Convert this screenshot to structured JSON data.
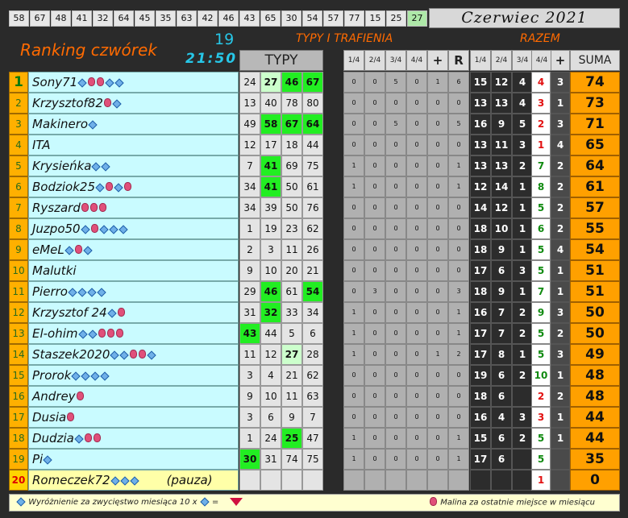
{
  "top_numbers": [
    "58",
    "67",
    "48",
    "41",
    "32",
    "64",
    "45",
    "35",
    "63",
    "42",
    "46",
    "43",
    "65",
    "30",
    "54",
    "57",
    "77",
    "15",
    "25",
    "27"
  ],
  "top_highlight_index": 19,
  "month": "Czerwiec  2021",
  "title": "Ranking czwórek",
  "round": "19",
  "clock": "21:50",
  "section_typy_trafienia": "TYPY I TRAFIENIA",
  "section_razem": "RAZEM",
  "header": {
    "typy": "TYPY",
    "score_cols": [
      "1/4",
      "2/4",
      "3/4",
      "4/4",
      "+",
      "R"
    ],
    "razem_cols": [
      "1/4",
      "2/4",
      "3/4",
      "4/4",
      "+"
    ],
    "suma": "SUMA"
  },
  "rows": [
    {
      "rank": "1",
      "name": "Sony71",
      "marks": [
        "d",
        "r",
        "r",
        "d",
        "d"
      ],
      "typy": [
        {
          "v": "24",
          "s": ""
        },
        {
          "v": "27",
          "s": "lg"
        },
        {
          "v": "46",
          "s": "g"
        },
        {
          "v": "67",
          "s": "g"
        }
      ],
      "scores": [
        "0",
        "0",
        "5",
        "0",
        "1",
        "6"
      ],
      "razem": [
        "15",
        "12",
        "4",
        "4",
        "3"
      ],
      "suma": "74"
    },
    {
      "rank": "2",
      "name": "Krzysztof82",
      "marks": [
        "r",
        "d"
      ],
      "typy": [
        {
          "v": "13",
          "s": ""
        },
        {
          "v": "40",
          "s": ""
        },
        {
          "v": "78",
          "s": ""
        },
        {
          "v": "80",
          "s": ""
        }
      ],
      "scores": [
        "0",
        "0",
        "0",
        "0",
        "0",
        "0"
      ],
      "razem": [
        "13",
        "13",
        "4",
        "3",
        "1"
      ],
      "suma": "73"
    },
    {
      "rank": "3",
      "name": "Makinero",
      "marks": [
        "d"
      ],
      "typy": [
        {
          "v": "49",
          "s": ""
        },
        {
          "v": "58",
          "s": "g"
        },
        {
          "v": "67",
          "s": "g"
        },
        {
          "v": "64",
          "s": "g"
        }
      ],
      "scores": [
        "0",
        "0",
        "5",
        "0",
        "0",
        "5"
      ],
      "razem": [
        "16",
        "9",
        "5",
        "2",
        "3"
      ],
      "suma": "71"
    },
    {
      "rank": "4",
      "name": "ITA",
      "marks": [],
      "typy": [
        {
          "v": "12",
          "s": ""
        },
        {
          "v": "17",
          "s": ""
        },
        {
          "v": "18",
          "s": ""
        },
        {
          "v": "44",
          "s": ""
        }
      ],
      "scores": [
        "0",
        "0",
        "0",
        "0",
        "0",
        "0"
      ],
      "razem": [
        "13",
        "11",
        "3",
        "1",
        "4"
      ],
      "suma": "65"
    },
    {
      "rank": "5",
      "name": "Krysieńka",
      "marks": [
        "d",
        "d"
      ],
      "typy": [
        {
          "v": "7",
          "s": ""
        },
        {
          "v": "41",
          "s": "g"
        },
        {
          "v": "69",
          "s": ""
        },
        {
          "v": "75",
          "s": ""
        }
      ],
      "scores": [
        "1",
        "0",
        "0",
        "0",
        "0",
        "1"
      ],
      "razem": [
        "13",
        "13",
        "2",
        "7",
        "2"
      ],
      "suma": "64"
    },
    {
      "rank": "6",
      "name": "Bodziok25",
      "marks": [
        "d",
        "r",
        "d",
        "r"
      ],
      "typy": [
        {
          "v": "34",
          "s": ""
        },
        {
          "v": "41",
          "s": "g"
        },
        {
          "v": "50",
          "s": ""
        },
        {
          "v": "61",
          "s": ""
        }
      ],
      "scores": [
        "1",
        "0",
        "0",
        "0",
        "0",
        "1"
      ],
      "razem": [
        "12",
        "14",
        "1",
        "8",
        "2"
      ],
      "suma": "61"
    },
    {
      "rank": "7",
      "name": "Ryszard",
      "marks": [
        "r",
        "r",
        "r"
      ],
      "typy": [
        {
          "v": "34",
          "s": ""
        },
        {
          "v": "39",
          "s": ""
        },
        {
          "v": "50",
          "s": ""
        },
        {
          "v": "76",
          "s": ""
        }
      ],
      "scores": [
        "0",
        "0",
        "0",
        "0",
        "0",
        "0"
      ],
      "razem": [
        "14",
        "12",
        "1",
        "5",
        "2"
      ],
      "suma": "57"
    },
    {
      "rank": "8",
      "name": "Juzpo50",
      "marks": [
        "d",
        "r",
        "d",
        "d",
        "d"
      ],
      "typy": [
        {
          "v": "1",
          "s": ""
        },
        {
          "v": "19",
          "s": ""
        },
        {
          "v": "23",
          "s": ""
        },
        {
          "v": "62",
          "s": ""
        }
      ],
      "scores": [
        "0",
        "0",
        "0",
        "0",
        "0",
        "0"
      ],
      "razem": [
        "18",
        "10",
        "1",
        "6",
        "2"
      ],
      "suma": "55"
    },
    {
      "rank": "9",
      "name": "eMeL",
      "marks": [
        "d",
        "r",
        "d"
      ],
      "typy": [
        {
          "v": "2",
          "s": ""
        },
        {
          "v": "3",
          "s": ""
        },
        {
          "v": "11",
          "s": ""
        },
        {
          "v": "26",
          "s": ""
        }
      ],
      "scores": [
        "0",
        "0",
        "0",
        "0",
        "0",
        "0"
      ],
      "razem": [
        "18",
        "9",
        "1",
        "5",
        "4"
      ],
      "suma": "54"
    },
    {
      "rank": "10",
      "name": "Malutki",
      "marks": [],
      "typy": [
        {
          "v": "9",
          "s": ""
        },
        {
          "v": "10",
          "s": ""
        },
        {
          "v": "20",
          "s": ""
        },
        {
          "v": "21",
          "s": ""
        }
      ],
      "scores": [
        "0",
        "0",
        "0",
        "0",
        "0",
        "0"
      ],
      "razem": [
        "17",
        "6",
        "3",
        "5",
        "1"
      ],
      "suma": "51"
    },
    {
      "rank": "11",
      "name": "Pierro",
      "marks": [
        "d",
        "d",
        "d",
        "d"
      ],
      "typy": [
        {
          "v": "29",
          "s": ""
        },
        {
          "v": "46",
          "s": "g"
        },
        {
          "v": "61",
          "s": ""
        },
        {
          "v": "54",
          "s": "g"
        }
      ],
      "scores": [
        "0",
        "3",
        "0",
        "0",
        "0",
        "3"
      ],
      "razem": [
        "18",
        "9",
        "1",
        "7",
        "1"
      ],
      "suma": "51"
    },
    {
      "rank": "12",
      "name": "Krzysztof 24",
      "marks": [
        "d",
        "r"
      ],
      "typy": [
        {
          "v": "31",
          "s": ""
        },
        {
          "v": "32",
          "s": "g"
        },
        {
          "v": "33",
          "s": ""
        },
        {
          "v": "34",
          "s": ""
        }
      ],
      "scores": [
        "1",
        "0",
        "0",
        "0",
        "0",
        "1"
      ],
      "razem": [
        "16",
        "7",
        "2",
        "9",
        "3"
      ],
      "suma": "50"
    },
    {
      "rank": "13",
      "name": "El-ohim",
      "marks": [
        "d",
        "d",
        "r",
        "r",
        "r"
      ],
      "typy": [
        {
          "v": "43",
          "s": "g"
        },
        {
          "v": "44",
          "s": ""
        },
        {
          "v": "5",
          "s": ""
        },
        {
          "v": "6",
          "s": ""
        }
      ],
      "scores": [
        "1",
        "0",
        "0",
        "0",
        "0",
        "1"
      ],
      "razem": [
        "17",
        "7",
        "2",
        "5",
        "2"
      ],
      "suma": "50"
    },
    {
      "rank": "14",
      "name": "Staszek2020",
      "marks": [
        "d",
        "d",
        "r",
        "r",
        "d"
      ],
      "typy": [
        {
          "v": "11",
          "s": ""
        },
        {
          "v": "12",
          "s": ""
        },
        {
          "v": "27",
          "s": "lg"
        },
        {
          "v": "28",
          "s": ""
        }
      ],
      "scores": [
        "1",
        "0",
        "0",
        "0",
        "1",
        "2"
      ],
      "razem": [
        "17",
        "8",
        "1",
        "5",
        "3"
      ],
      "suma": "49"
    },
    {
      "rank": "15",
      "name": "Prorok",
      "marks": [
        "d",
        "d",
        "d",
        "d"
      ],
      "typy": [
        {
          "v": "3",
          "s": ""
        },
        {
          "v": "4",
          "s": ""
        },
        {
          "v": "21",
          "s": ""
        },
        {
          "v": "62",
          "s": ""
        }
      ],
      "scores": [
        "0",
        "0",
        "0",
        "0",
        "0",
        "0"
      ],
      "razem": [
        "19",
        "6",
        "2",
        "10",
        "1"
      ],
      "suma": "48"
    },
    {
      "rank": "16",
      "name": "Andrey",
      "marks": [
        "r"
      ],
      "typy": [
        {
          "v": "9",
          "s": ""
        },
        {
          "v": "10",
          "s": ""
        },
        {
          "v": "11",
          "s": ""
        },
        {
          "v": "63",
          "s": ""
        }
      ],
      "scores": [
        "0",
        "0",
        "0",
        "0",
        "0",
        "0"
      ],
      "razem": [
        "18",
        "6",
        "",
        "2",
        "2"
      ],
      "suma": "48"
    },
    {
      "rank": "17",
      "name": "Dusia",
      "marks": [
        "r"
      ],
      "typy": [
        {
          "v": "3",
          "s": ""
        },
        {
          "v": "6",
          "s": ""
        },
        {
          "v": "9",
          "s": ""
        },
        {
          "v": "7",
          "s": ""
        }
      ],
      "scores": [
        "0",
        "0",
        "0",
        "0",
        "0",
        "0"
      ],
      "razem": [
        "16",
        "4",
        "3",
        "3",
        "1"
      ],
      "suma": "44"
    },
    {
      "rank": "18",
      "name": "Dudzia",
      "marks": [
        "d",
        "r",
        "r"
      ],
      "typy": [
        {
          "v": "1",
          "s": ""
        },
        {
          "v": "24",
          "s": ""
        },
        {
          "v": "25",
          "s": "g"
        },
        {
          "v": "47",
          "s": ""
        }
      ],
      "scores": [
        "1",
        "0",
        "0",
        "0",
        "0",
        "1"
      ],
      "razem": [
        "15",
        "6",
        "2",
        "5",
        "1"
      ],
      "suma": "44"
    },
    {
      "rank": "19",
      "name": "Pi",
      "marks": [
        "d"
      ],
      "typy": [
        {
          "v": "30",
          "s": "g"
        },
        {
          "v": "31",
          "s": ""
        },
        {
          "v": "74",
          "s": ""
        },
        {
          "v": "75",
          "s": ""
        }
      ],
      "scores": [
        "1",
        "0",
        "0",
        "0",
        "0",
        "1"
      ],
      "razem": [
        "17",
        "6",
        "",
        "5",
        ""
      ],
      "suma": "35"
    },
    {
      "rank": "20",
      "name": "Romeczek72",
      "marks": [
        "d",
        "d",
        "d"
      ],
      "pauza": "(pauza)",
      "typy": [
        {
          "v": "",
          "s": ""
        },
        {
          "v": "",
          "s": ""
        },
        {
          "v": "",
          "s": ""
        },
        {
          "v": "",
          "s": ""
        }
      ],
      "scores": [
        "",
        "",
        "",
        "",
        "",
        ""
      ],
      "razem": [
        "",
        "",
        "",
        "1",
        ""
      ],
      "suma": "0"
    }
  ],
  "footer": {
    "left": "Wyróżnienie za zwycięstwo miesiąca  10 x",
    "equals": "=",
    "right": "Malina za ostatnie miejsce w miesiącu"
  },
  "colors": {
    "orange": "#ff6a00",
    "cyan": "#27c7e8",
    "hit_green": "#22ee22",
    "rank_orange": "#ffb000"
  }
}
